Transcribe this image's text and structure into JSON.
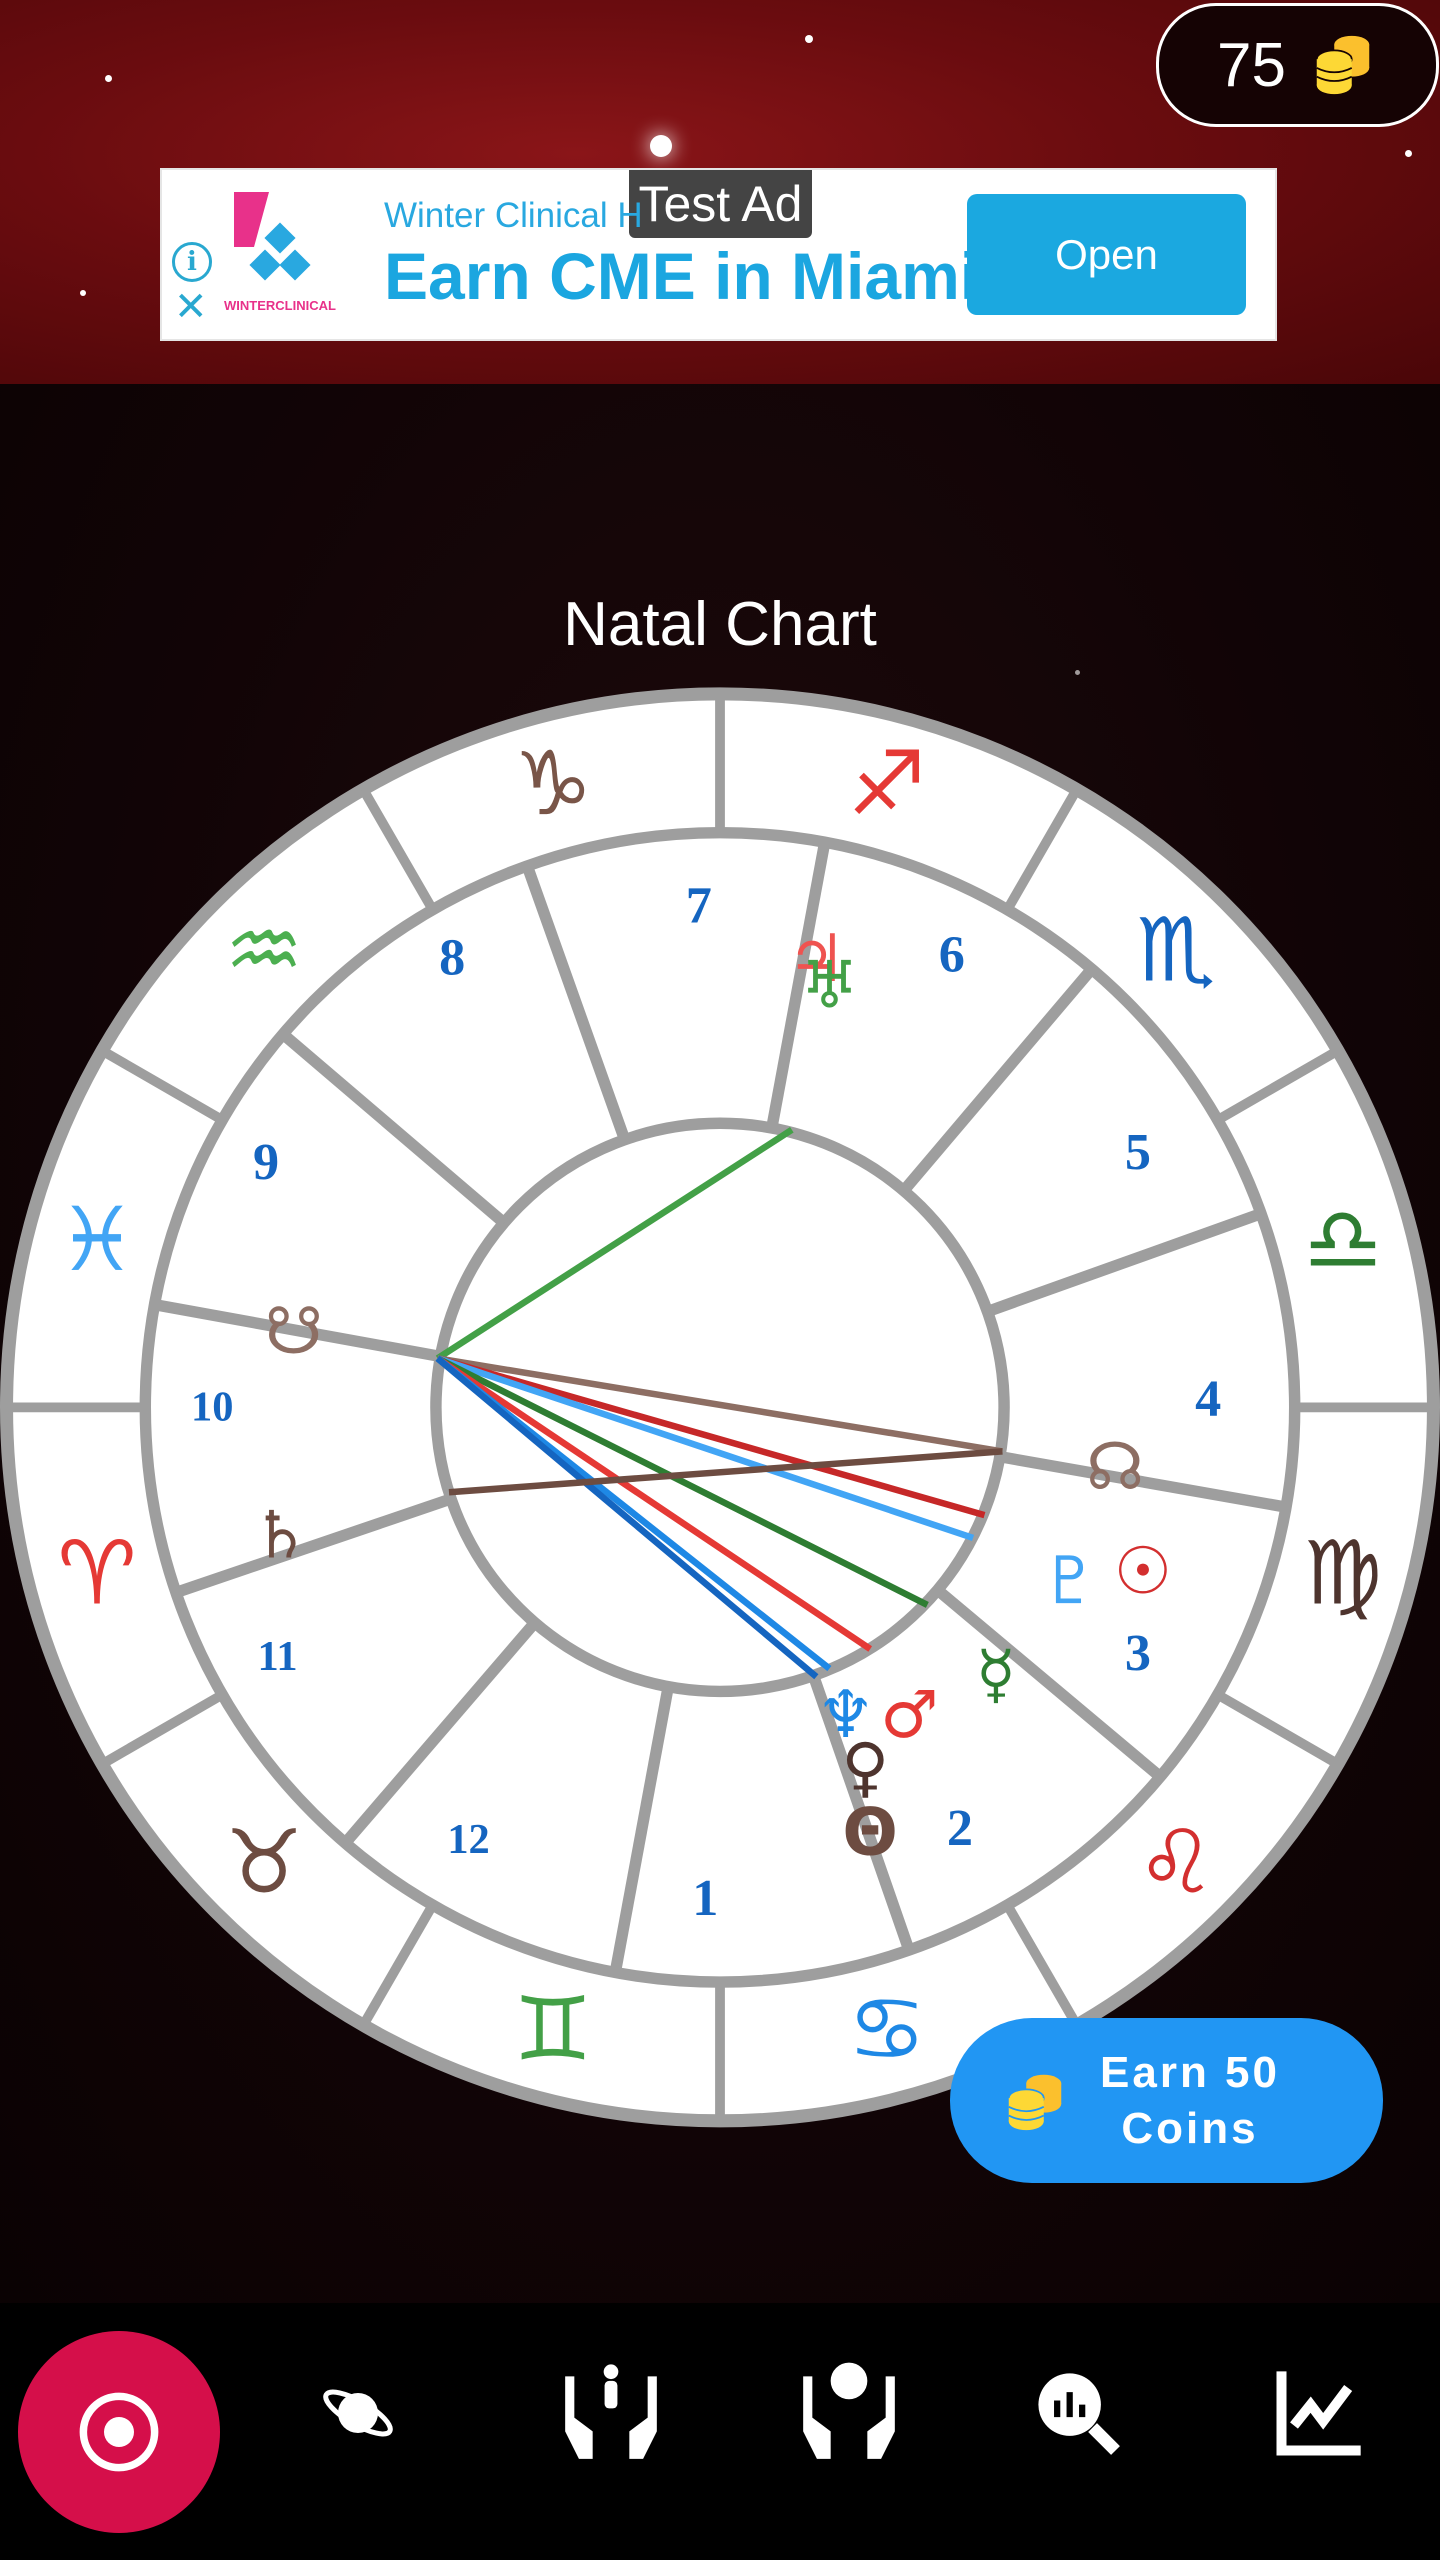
{
  "header": {
    "coin_count": "75",
    "coin_icon": "coin-stack-icon"
  },
  "ad": {
    "label": "Test Ad",
    "advertiser": "Winter Clinical H",
    "headline": "Earn CME in Miami",
    "cta": "Open",
    "logo_text": "WINTERCLINICAL",
    "info_icon": "info-icon",
    "close_icon": "close-icon"
  },
  "chart": {
    "title": "Natal Chart",
    "ring_color": "#9e9e9e",
    "zodiac": [
      {
        "name": "libra",
        "glyph": "♎",
        "color": "#2e7d32"
      },
      {
        "name": "scorpio",
        "glyph": "♏",
        "color": "#1565c0"
      },
      {
        "name": "sagittarius",
        "glyph": "♐",
        "color": "#e53935"
      },
      {
        "name": "capricorn",
        "glyph": "♑",
        "color": "#795548"
      },
      {
        "name": "aquarius",
        "glyph": "♒",
        "color": "#4caf50"
      },
      {
        "name": "pisces",
        "glyph": "♓",
        "color": "#42a5f5"
      },
      {
        "name": "aries",
        "glyph": "♈",
        "color": "#e53935"
      },
      {
        "name": "taurus",
        "glyph": "♉",
        "color": "#6d4c41"
      },
      {
        "name": "gemini",
        "glyph": "♊",
        "color": "#43a047"
      },
      {
        "name": "cancer",
        "glyph": "♋",
        "color": "#1e88e5"
      },
      {
        "name": "leo",
        "glyph": "♌",
        "color": "#d32f2f"
      },
      {
        "name": "virgo",
        "glyph": "♍",
        "color": "#4e342e"
      }
    ],
    "houses": [
      "1",
      "2",
      "3",
      "4",
      "5",
      "6",
      "7",
      "8",
      "9",
      "10",
      "11",
      "12"
    ],
    "house_color": "#1565c0",
    "planets": [
      {
        "name": "south-node",
        "glyph": "☋",
        "color": "#8d6e63"
      },
      {
        "name": "saturn",
        "glyph": "♄",
        "color": "#6d4c41"
      },
      {
        "name": "north-node",
        "glyph": "☊",
        "color": "#8d6e63"
      },
      {
        "name": "pluto",
        "glyph": "♇",
        "color": "#42a5f5"
      },
      {
        "name": "sun",
        "glyph": "☉",
        "color": "#d32f2f"
      },
      {
        "name": "mercury",
        "glyph": "☿",
        "color": "#2e7d32"
      },
      {
        "name": "neptune",
        "glyph": "♆",
        "color": "#1e88e5"
      },
      {
        "name": "mars",
        "glyph": "♂",
        "color": "#e53935"
      },
      {
        "name": "venus",
        "glyph": "♀",
        "color": "#4e342e"
      },
      {
        "name": "moon",
        "glyph": "☽",
        "color": "#1565c0"
      },
      {
        "name": "point",
        "glyph": "Θ",
        "color": "#6d4c41"
      },
      {
        "name": "jupiter",
        "glyph": "♃",
        "color": "#ef5350"
      },
      {
        "name": "uranus",
        "glyph": "♅",
        "color": "#43a047"
      }
    ],
    "aspect_colors": [
      "#43a047",
      "#8d6e63",
      "#c62828",
      "#42a5f5",
      "#2e7d32",
      "#e53935",
      "#1e88e5",
      "#1565c0",
      "#6d4c41"
    ]
  },
  "earn_button": {
    "label_line1": "Earn 50",
    "label_line2": "Coins"
  },
  "nav": {
    "accent": "#d50f4a",
    "items": [
      {
        "icon": "target-icon"
      },
      {
        "icon": "planet-icon"
      },
      {
        "icon": "family-hands-icon"
      },
      {
        "icon": "person-hands-icon"
      },
      {
        "icon": "search-chart-icon"
      },
      {
        "icon": "line-chart-icon"
      }
    ]
  }
}
